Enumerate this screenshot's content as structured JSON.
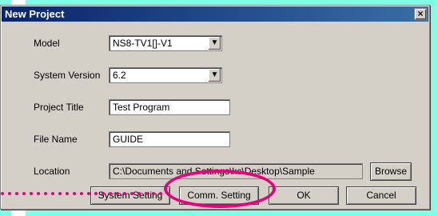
{
  "window": {
    "title": "New Project",
    "close_glyph": "×"
  },
  "form": {
    "model": {
      "label": "Model",
      "value": "NS8-TV1[]-V1"
    },
    "system_version": {
      "label": "System Version",
      "value": "6.2"
    },
    "project_title": {
      "label": "Project Title",
      "value": "Test Program"
    },
    "file_name": {
      "label": "File Name",
      "value": "GUIDE"
    },
    "location": {
      "label": "Location",
      "value": "C:\\Documents and Settings\\kc\\Desktop\\Sample"
    }
  },
  "buttons": {
    "browse": "Browse",
    "system_setting": "System Setting",
    "comm_setting": "Comm. Setting",
    "ok": "OK",
    "cancel": "Cancel"
  },
  "annotation": {
    "color": "#e6007e",
    "shape": "ellipse",
    "target": "Comm. Setting"
  },
  "colors": {
    "titlebar_start": "#0a246a",
    "titlebar_end": "#3a6ea5",
    "dialog_face": "#d4d0c8",
    "backdrop": "#7fffe6"
  }
}
